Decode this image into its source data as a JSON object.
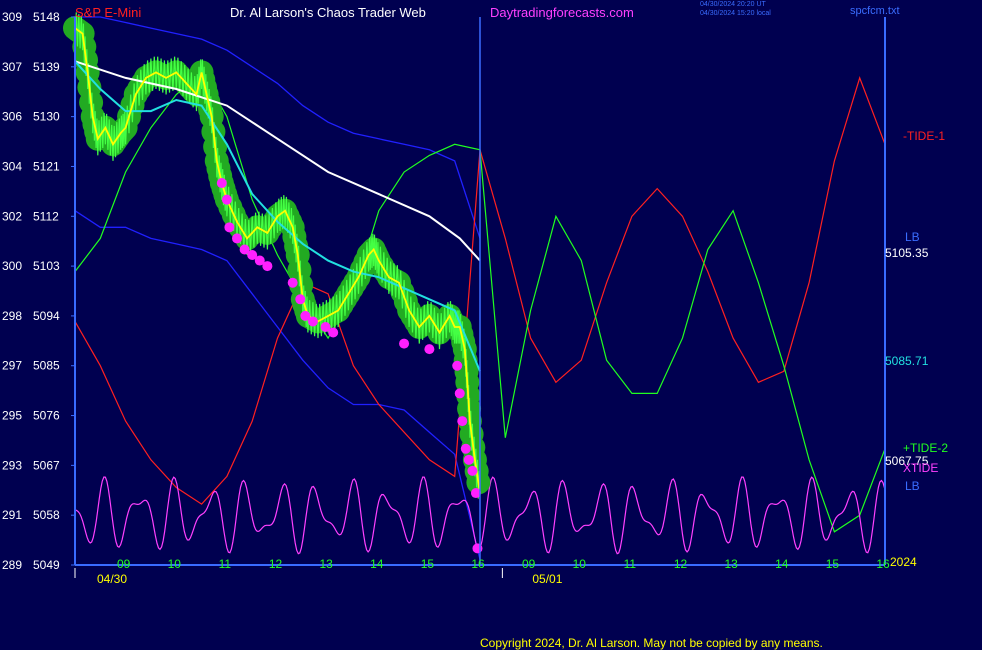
{
  "header": {
    "symbol": "S&P E-Mini",
    "title": "Dr. Al Larson's Chaos Trader Web",
    "site": "Daytradingforecasts.com",
    "timestamp_ut": "04/30/2024 20:20 UT",
    "timestamp_local": "04/30/2024 15:20 local",
    "file": "spcfcm.txt"
  },
  "footer": {
    "copyright": "Copyright 2024, Dr. Al Larson. May not be copied by any means."
  },
  "colors": {
    "background": "#000050",
    "axis": "#3a6cff",
    "price": "#ffff00",
    "bands": "#22aa22",
    "ma_slow": "#ffffff",
    "ma_fast": "#22e0e0",
    "tide1": "#ff2020",
    "tide2": "#20ff20",
    "xtide": "#ff40ff",
    "env": "#2020ff",
    "date_label": "#ffff00",
    "hour_label": "#20ff20"
  },
  "chart_data": {
    "type": "line",
    "ylim": [
      5049,
      5148
    ],
    "y_ticks": [
      {
        "left": "309",
        "price": 5148
      },
      {
        "left": "307",
        "price": 5139
      },
      {
        "left": "306",
        "price": 5130
      },
      {
        "left": "304",
        "price": 5121
      },
      {
        "left": "302",
        "price": 5112
      },
      {
        "left": "300",
        "price": 5103
      },
      {
        "left": "298",
        "price": 5094
      },
      {
        "left": "297",
        "price": 5085
      },
      {
        "left": "295",
        "price": 5076
      },
      {
        "left": "293",
        "price": 5067
      },
      {
        "left": "291",
        "price": 5058
      },
      {
        "left": "289",
        "price": 5049
      }
    ],
    "x_ticks": [
      {
        "h": 9,
        "label": "09"
      },
      {
        "h": 10,
        "label": "10"
      },
      {
        "h": 11,
        "label": "11"
      },
      {
        "h": 12,
        "label": "12"
      },
      {
        "h": 13,
        "label": "13"
      },
      {
        "h": 14,
        "label": "14"
      },
      {
        "h": 15,
        "label": "15"
      },
      {
        "h": 16,
        "label": "16"
      },
      {
        "h": 17,
        "label": "09"
      },
      {
        "h": 18,
        "label": "10"
      },
      {
        "h": 19,
        "label": "11"
      },
      {
        "h": 20,
        "label": "12"
      },
      {
        "h": 21,
        "label": "13"
      },
      {
        "h": 22,
        "label": "14"
      },
      {
        "h": 23,
        "label": "15"
      },
      {
        "h": 24,
        "label": "16"
      }
    ],
    "x_range": [
      8,
      24
    ],
    "now_x": 16,
    "dates": [
      {
        "h": 8,
        "label": "04/30"
      },
      {
        "h": 16.6,
        "label": "05/01"
      }
    ],
    "year_label": "2024",
    "price": {
      "name": "S&P E-Mini",
      "x": [
        8,
        8.15,
        8.25,
        8.35,
        8.45,
        8.6,
        8.75,
        8.9,
        9.0,
        9.2,
        9.4,
        9.6,
        9.8,
        10.0,
        10.2,
        10.4,
        10.5,
        10.6,
        10.7,
        10.8,
        10.9,
        11.0,
        11.2,
        11.4,
        11.6,
        11.8,
        12.0,
        12.15,
        12.3,
        12.4,
        12.5,
        12.6,
        12.8,
        13.0,
        13.2,
        13.4,
        13.6,
        13.8,
        13.9,
        14.0,
        14.2,
        14.4,
        14.6,
        14.8,
        15.0,
        15.2,
        15.4,
        15.5,
        15.6,
        15.7,
        15.75,
        15.8,
        15.9,
        16.0
      ],
      "y": [
        5146,
        5145,
        5138,
        5130,
        5126,
        5128,
        5125,
        5127,
        5128,
        5134,
        5137,
        5138,
        5137,
        5138,
        5136,
        5134,
        5138,
        5134,
        5130,
        5122,
        5118,
        5115,
        5111,
        5108,
        5110,
        5109,
        5112,
        5113,
        5110,
        5105,
        5097,
        5094,
        5093,
        5094,
        5095,
        5098,
        5101,
        5105,
        5106,
        5104,
        5101,
        5100,
        5095,
        5092,
        5094,
        5091,
        5094,
        5092,
        5092,
        5088,
        5082,
        5075,
        5068,
        5062
      ]
    },
    "ma_fast": {
      "x": [
        8,
        8.5,
        9,
        9.5,
        10,
        10.5,
        11,
        11.5,
        12,
        12.5,
        13,
        13.5,
        14,
        14.5,
        15,
        15.5,
        16
      ],
      "y": [
        5140,
        5135,
        5131,
        5131,
        5133,
        5132,
        5125,
        5116,
        5111,
        5107,
        5104,
        5102,
        5101,
        5099,
        5097,
        5095,
        5084
      ]
    },
    "ma_slow": {
      "x": [
        8,
        9,
        10,
        11,
        12,
        13,
        14,
        15,
        15.6,
        16
      ],
      "y": [
        5140,
        5137,
        5135,
        5132,
        5126,
        5120,
        5116,
        5112,
        5108,
        5104
      ]
    },
    "tide1": {
      "name": "-TIDE-1",
      "x": [
        8,
        8.5,
        9,
        9.5,
        10,
        10.5,
        11,
        11.5,
        12,
        12.5,
        13,
        13.5,
        14,
        14.5,
        15,
        15.5,
        16,
        16.5,
        17,
        17.5,
        18,
        18.5,
        19,
        19.5,
        20,
        20.5,
        21,
        21.5,
        22,
        22.5,
        23,
        23.5,
        24
      ],
      "y": [
        5093,
        5085,
        5075,
        5068,
        5063,
        5060,
        5065,
        5075,
        5090,
        5100,
        5098,
        5085,
        5078,
        5073,
        5068,
        5065,
        5124,
        5108,
        5090,
        5082,
        5086,
        5100,
        5112,
        5117,
        5112,
        5102,
        5090,
        5082,
        5084,
        5100,
        5122,
        5137,
        5125
      ]
    },
    "tide2": {
      "name": "+TIDE-2",
      "x": [
        8,
        8.5,
        9,
        9.5,
        10,
        10.5,
        11,
        11.5,
        12,
        12.5,
        13,
        13.5,
        14,
        14.5,
        15,
        15.5,
        16,
        16.5,
        17,
        17.5,
        18,
        18.5,
        19,
        19.5,
        20,
        20.5,
        21,
        21.5,
        22,
        22.5,
        23,
        23.5,
        24
      ],
      "y": [
        5102,
        5108,
        5120,
        5128,
        5134,
        5138,
        5130,
        5115,
        5105,
        5097,
        5090,
        5098,
        5113,
        5120,
        5123,
        5125,
        5124,
        5072,
        5095,
        5112,
        5104,
        5086,
        5080,
        5080,
        5090,
        5106,
        5113,
        5100,
        5085,
        5068,
        5055,
        5058,
        5070
      ]
    },
    "env_upper": {
      "x": [
        8,
        8.5,
        9,
        9.5,
        10,
        10.5,
        11,
        11.5,
        12,
        12.5,
        13,
        13.5,
        14,
        14.5,
        15,
        15.5,
        16
      ],
      "y": [
        5148,
        5148,
        5147,
        5146,
        5145,
        5144,
        5142,
        5139,
        5136,
        5132,
        5129,
        5127,
        5126,
        5125,
        5124,
        5122,
        5108
      ]
    },
    "env_lower": {
      "x": [
        8,
        8.5,
        9,
        9.5,
        10,
        10.5,
        11,
        11.5,
        12,
        12.5,
        13,
        13.5,
        14,
        14.5,
        15,
        15.5,
        16
      ],
      "y": [
        5113,
        5110,
        5110,
        5108,
        5107,
        5106,
        5104,
        5098,
        5092,
        5086,
        5081,
        5078,
        5078,
        5077,
        5073,
        5069,
        5050
      ]
    },
    "xtide": {
      "name": "XTIDE",
      "periods_h": [
        0.7,
        0.45
      ],
      "amplitudes": [
        4.5,
        2.5
      ],
      "baseline": 5058
    },
    "magenta_dots": {
      "x": [
        10.9,
        11.0,
        11.05,
        11.2,
        11.35,
        11.5,
        11.65,
        11.8,
        12.3,
        12.45,
        12.55,
        12.7,
        12.95,
        13.1,
        14.5,
        15.0,
        15.55,
        15.6,
        15.65,
        15.72,
        15.78,
        15.85,
        15.92,
        15.95
      ],
      "y": [
        5118,
        5115,
        5110,
        5108,
        5106,
        5105,
        5104,
        5103,
        5100,
        5097,
        5094,
        5093,
        5092,
        5091,
        5089,
        5088,
        5085,
        5080,
        5075,
        5070,
        5068,
        5066,
        5062,
        5052
      ]
    },
    "labels": {
      "tide1": "-TIDE-1",
      "lb1": "LB",
      "value1": "5105.35",
      "value2": "5085.71",
      "tide2": "+TIDE-2",
      "value3": "5067.75",
      "xtide": "XTIDE",
      "lb2": "LB"
    }
  }
}
